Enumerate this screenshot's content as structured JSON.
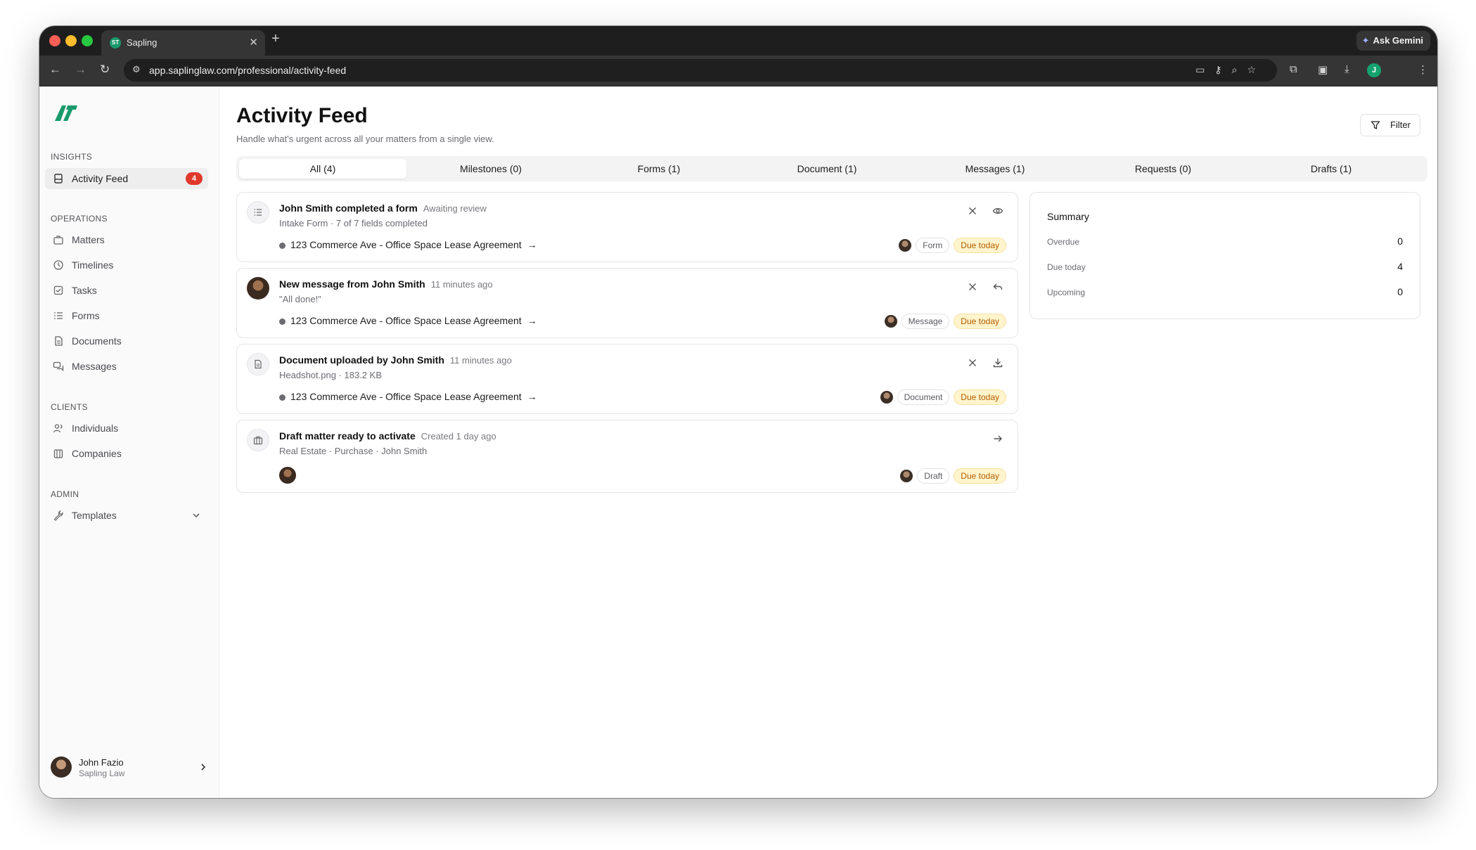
{
  "browser": {
    "tab_title": "Sapling",
    "tab_favicon_text": "ST",
    "url": "app.saplinglaw.com/professional/activity-feed",
    "ask_gemini": "Ask Gemini",
    "profile_initial": "J"
  },
  "sidebar": {
    "sections": {
      "insights": "INSIGHTS",
      "operations": "OPERATIONS",
      "clients": "CLIENTS",
      "admin": "ADMIN"
    },
    "items": {
      "activity_feed": {
        "label": "Activity Feed",
        "badge": "4"
      },
      "matters": {
        "label": "Matters"
      },
      "timelines": {
        "label": "Timelines"
      },
      "tasks": {
        "label": "Tasks"
      },
      "forms": {
        "label": "Forms"
      },
      "documents": {
        "label": "Documents"
      },
      "messages": {
        "label": "Messages"
      },
      "individuals": {
        "label": "Individuals"
      },
      "companies": {
        "label": "Companies"
      },
      "templates": {
        "label": "Templates"
      }
    },
    "user": {
      "name": "John Fazio",
      "org": "Sapling Law"
    }
  },
  "main": {
    "title": "Activity Feed",
    "subtitle": "Handle what's urgent across all your matters from a single view.",
    "filter_label": "Filter",
    "tabs": [
      {
        "label": "All (4)"
      },
      {
        "label": "Milestones (0)"
      },
      {
        "label": "Forms (1)"
      },
      {
        "label": "Document (1)"
      },
      {
        "label": "Messages (1)"
      },
      {
        "label": "Requests (0)"
      },
      {
        "label": "Drafts (1)"
      }
    ],
    "feed": [
      {
        "title": "John Smith completed a form",
        "meta": "Awaiting review",
        "desc": "Intake Form · 7 of 7 fields completed",
        "matter": "123 Commerce Ave - Office Space Lease Agreement",
        "type": "Form",
        "due": "Due today"
      },
      {
        "title": "New message from John Smith",
        "meta": "11 minutes ago",
        "desc": "\"All done!\"",
        "matter": "123 Commerce Ave - Office Space Lease Agreement",
        "type": "Message",
        "due": "Due today"
      },
      {
        "title": "Document uploaded by John Smith",
        "meta": "11 minutes ago",
        "desc": "Headshot.png · 183.2 KB",
        "matter": "123 Commerce Ave - Office Space Lease Agreement",
        "type": "Document",
        "due": "Due today"
      },
      {
        "title": "Draft matter ready to activate",
        "meta": "Created 1 day ago",
        "desc": "Real Estate · Purchase · John Smith",
        "type": "Draft",
        "due": "Due today"
      }
    ],
    "summary": {
      "title": "Summary",
      "rows": [
        {
          "label": "Overdue",
          "value": "0"
        },
        {
          "label": "Due today",
          "value": "4"
        },
        {
          "label": "Upcoming",
          "value": "0"
        }
      ]
    }
  },
  "colors": {
    "brand": "#1a9a6c",
    "badge": "#e0392b",
    "due_bg": "#fff4cc",
    "due_text": "#b25c00"
  }
}
